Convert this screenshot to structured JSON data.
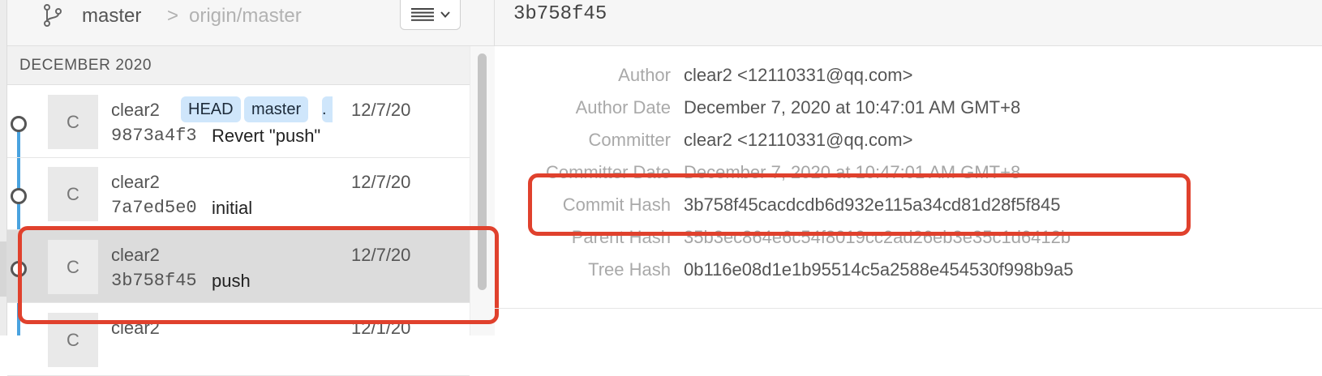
{
  "branch_bar": {
    "branch": "master",
    "separator": ">",
    "remote": "origin/master"
  },
  "sidebar": {
    "section_header": "DECEMBER 2020"
  },
  "commits": [
    {
      "avatar": "C",
      "author": "clear2",
      "date": "12/7/20",
      "hash": "9873a4f3",
      "message": "Revert \"push\"",
      "tags": [
        "HEAD",
        "master",
        "."
      ]
    },
    {
      "avatar": "C",
      "author": "clear2",
      "date": "12/7/20",
      "hash": "7a7ed5e0",
      "message": "initial",
      "tags": []
    },
    {
      "avatar": "C",
      "author": "clear2",
      "date": "12/7/20",
      "hash": "3b758f45",
      "message": "push",
      "tags": [],
      "selected": true
    },
    {
      "avatar": "C",
      "author": "clear2",
      "date": "12/1/20",
      "hash": "",
      "message": "",
      "tags": []
    }
  ],
  "detail": {
    "title_hash": "3b758f45",
    "fields": [
      {
        "label": "Author",
        "value": "clear2 <12110331@qq.com>"
      },
      {
        "label": "Author Date",
        "value": "December 7, 2020 at 10:47:01 AM GMT+8"
      },
      {
        "label": "Committer",
        "value": "clear2 <12110331@qq.com>"
      },
      {
        "label": "Committer Date",
        "value": "December 7, 2020 at 10:47:01 AM GMT+8"
      },
      {
        "label": "Commit Hash",
        "value": "3b758f45cacdcdb6d932e115a34cd81d28f5f845"
      },
      {
        "label": "Parent Hash",
        "value": "35b3ec864e6c54f8019cc2ad26eb3e35c1d6412b"
      },
      {
        "label": "Tree Hash",
        "value": "0b116e08d1e1b95514c5a2588e454530f998b9a5"
      }
    ]
  },
  "colors": {
    "highlight_box": "#e0412d",
    "tag_background": "#cfe6fb",
    "graph_line": "#4aa3df",
    "selected_row": "#dcdcdc"
  },
  "icons": [
    "branch-icon",
    "chevron-right-icon",
    "list-view-icon",
    "chevron-down-icon",
    "commit-node-icon"
  ]
}
